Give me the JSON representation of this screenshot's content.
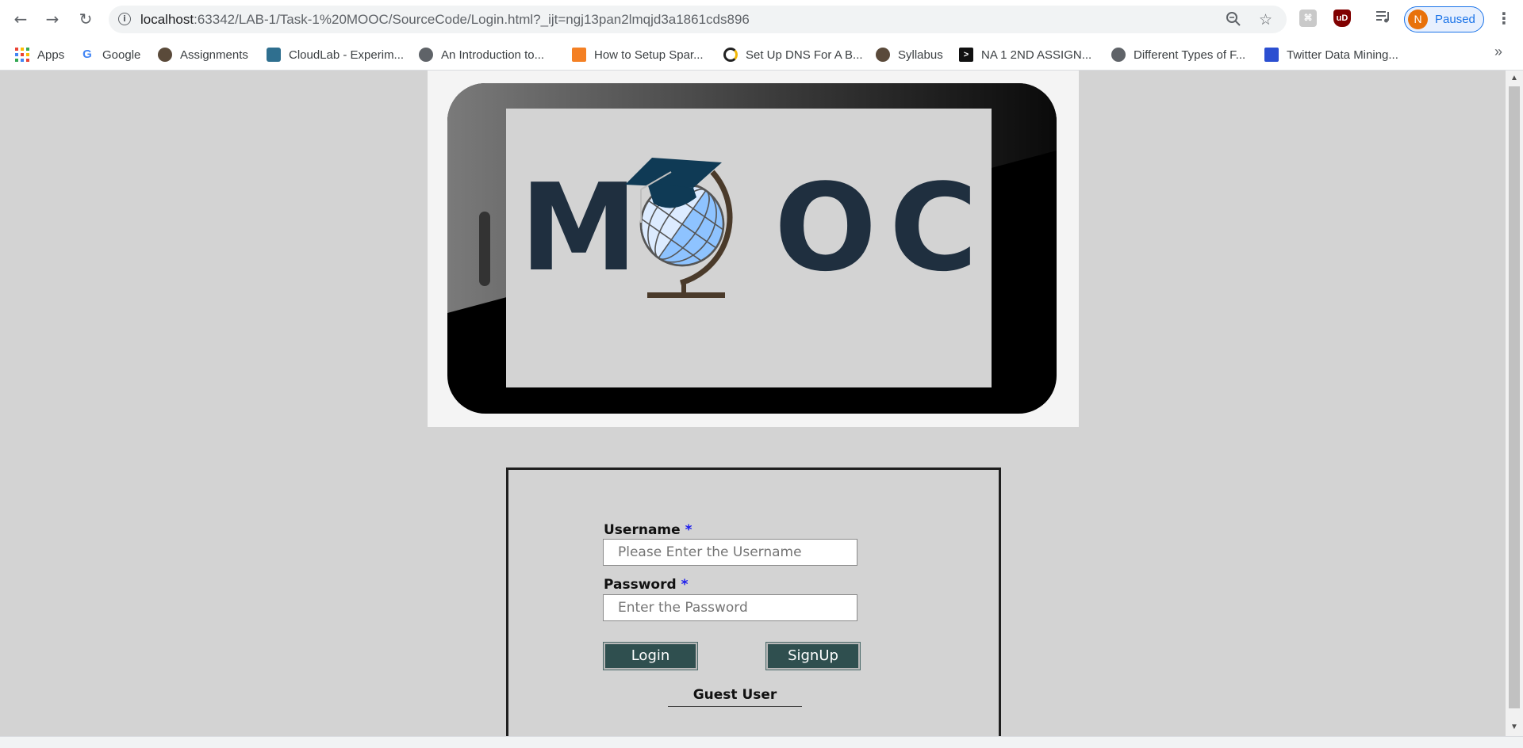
{
  "browser": {
    "url_host": "localhost",
    "url_path": ":63342/LAB-1/Task-1%20MOOC/SourceCode/Login.html?_ijt=ngj13pan2lmqjd3a1861cds896",
    "profile_initial": "N",
    "profile_status": "Paused",
    "extension_ud": "uD"
  },
  "bookmarks": [
    {
      "label": "Apps"
    },
    {
      "label": "Google"
    },
    {
      "label": "Assignments"
    },
    {
      "label": "CloudLab - Experim..."
    },
    {
      "label": "An Introduction to..."
    },
    {
      "label": "How to Setup Spar..."
    },
    {
      "label": "Set Up DNS For A B..."
    },
    {
      "label": "Syllabus"
    },
    {
      "label": "NA 1 2ND ASSIGN..."
    },
    {
      "label": "Different Types of F..."
    },
    {
      "label": "Twitter Data Mining..."
    }
  ],
  "banner": {
    "logo_letters": [
      "M",
      "O",
      "C"
    ]
  },
  "login": {
    "username_label": "Username",
    "username_required": "*",
    "username_placeholder": "Please Enter the Username",
    "password_label": "Password",
    "password_required": "*",
    "password_placeholder": "Enter the Password",
    "login_button": "Login",
    "signup_button": "SignUp",
    "guest_link": "Guest User"
  },
  "colors": {
    "page_background": "#d3d3d3",
    "button_background": "#2f4f4f",
    "logo_text": "#1f2f3f",
    "required_star": "#1a1aee"
  }
}
